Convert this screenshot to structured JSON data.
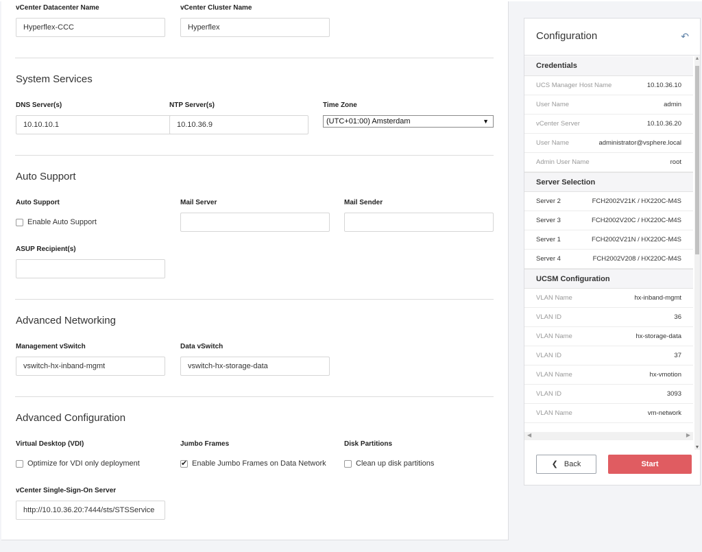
{
  "form": {
    "vcenter_datacenter_label": "vCenter Datacenter Name",
    "vcenter_datacenter_value": "Hyperflex-CCC",
    "vcenter_cluster_label": "vCenter Cluster Name",
    "vcenter_cluster_value": "Hyperflex",
    "system_services_title": "System Services",
    "dns_label": "DNS Server(s)",
    "dns_value": "10.10.10.1",
    "ntp_label": "NTP Server(s)",
    "ntp_value": "10.10.36.9",
    "timezone_label": "Time Zone",
    "timezone_value": "(UTC+01:00) Amsterdam",
    "auto_support_title": "Auto Support",
    "auto_support_label": "Auto Support",
    "enable_auto_support": "Enable Auto Support",
    "mail_server_label": "Mail Server",
    "mail_server_value": "",
    "mail_sender_label": "Mail Sender",
    "mail_sender_value": "",
    "asup_label": "ASUP Recipient(s)",
    "asup_value": "",
    "adv_networking_title": "Advanced Networking",
    "mgmt_vswitch_label": "Management vSwitch",
    "mgmt_vswitch_value": "vswitch-hx-inband-mgmt",
    "data_vswitch_label": "Data vSwitch",
    "data_vswitch_value": "vswitch-hx-storage-data",
    "adv_config_title": "Advanced Configuration",
    "vdi_label": "Virtual Desktop (VDI)",
    "vdi_checkbox": "Optimize for VDI only deployment",
    "jumbo_label": "Jumbo Frames",
    "jumbo_checkbox": "Enable Jumbo Frames on Data Network",
    "disk_label": "Disk Partitions",
    "disk_checkbox": "Clean up disk partitions",
    "sso_label": "vCenter Single-Sign-On Server",
    "sso_value": "http://10.10.36.20:7444/sts/STSService"
  },
  "config": {
    "title": "Configuration",
    "credentials_title": "Credentials",
    "credentials": [
      {
        "k": "UCS Manager Host Name",
        "v": "10.10.36.10"
      },
      {
        "k": "User Name",
        "v": "admin"
      },
      {
        "k": "vCenter Server",
        "v": "10.10.36.20"
      },
      {
        "k": "User Name",
        "v": "administrator@vsphere.local"
      },
      {
        "k": "Admin User Name",
        "v": "root"
      }
    ],
    "server_selection_title": "Server Selection",
    "servers": [
      {
        "k": "Server 2",
        "v": "FCH2002V21K / HX220C-M4S"
      },
      {
        "k": "Server 3",
        "v": "FCH2002V20C / HX220C-M4S"
      },
      {
        "k": "Server 1",
        "v": "FCH2002V21N / HX220C-M4S"
      },
      {
        "k": "Server 4",
        "v": "FCH2002V208 / HX220C-M4S"
      }
    ],
    "ucsm_title": "UCSM Configuration",
    "ucsm": [
      {
        "k": "VLAN Name",
        "v": "hx-inband-mgmt"
      },
      {
        "k": "VLAN ID",
        "v": "36"
      },
      {
        "k": "VLAN Name",
        "v": "hx-storage-data"
      },
      {
        "k": "VLAN ID",
        "v": "37"
      },
      {
        "k": "VLAN Name",
        "v": "hx-vmotion"
      },
      {
        "k": "VLAN ID",
        "v": "3093"
      },
      {
        "k": "VLAN Name",
        "v": "vm-network"
      }
    ],
    "back_label": "Back",
    "start_label": "Start"
  },
  "colors": {
    "start_button": "#e05c61",
    "back_icon": "#5b7fa6"
  },
  "icons": {
    "back": "chevron-left-icon",
    "config_back": "return-arrow-icon",
    "timezone_dropdown": "triangle-down-icon"
  }
}
